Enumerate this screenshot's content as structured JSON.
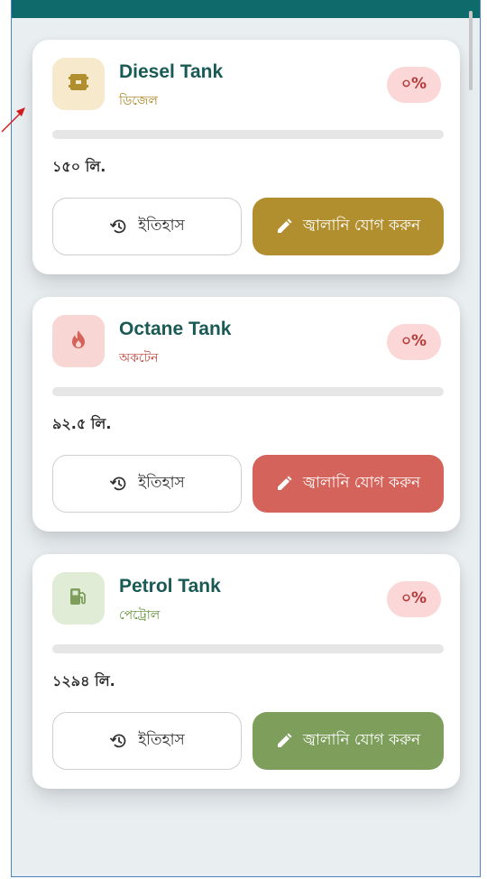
{
  "tanks": [
    {
      "title": "Diesel Tank",
      "subtitle": "ডিজেল",
      "percent": "০%",
      "level_fraction": 0,
      "amount": "১৫০ লি.",
      "history_label": "ইতিহাস",
      "add_label": "জ্বালানি যোগ করুন",
      "icon": "fuel-barrel-icon",
      "accent": "#b28f2e",
      "icon_bg": "#f6e9cc",
      "subtitle_color": "#a8801d"
    },
    {
      "title": "Octane Tank",
      "subtitle": "অকটেন",
      "percent": "০%",
      "level_fraction": 0,
      "amount": "৯২.৫ লি.",
      "history_label": "ইতিহাস",
      "add_label": "জ্বালানি যোগ করুন",
      "icon": "flame-icon",
      "accent": "#d4645b",
      "icon_bg": "#f8d6d4",
      "subtitle_color": "#c0463c"
    },
    {
      "title": "Petrol Tank",
      "subtitle": "পেট্রোল",
      "percent": "০%",
      "level_fraction": 0,
      "amount": "১২৯৪ লি.",
      "history_label": "ইতিহাস",
      "add_label": "জ্বালানি যোগ করুন",
      "icon": "gas-pump-icon",
      "accent": "#7e9e5c",
      "icon_bg": "#e1ecd7",
      "subtitle_color": "#5f8c33"
    }
  ],
  "colors": {
    "header": "#0f6b6b",
    "badge_bg": "#fbd7d7",
    "badge_text": "#b53b3b",
    "title": "#1a5a55"
  }
}
